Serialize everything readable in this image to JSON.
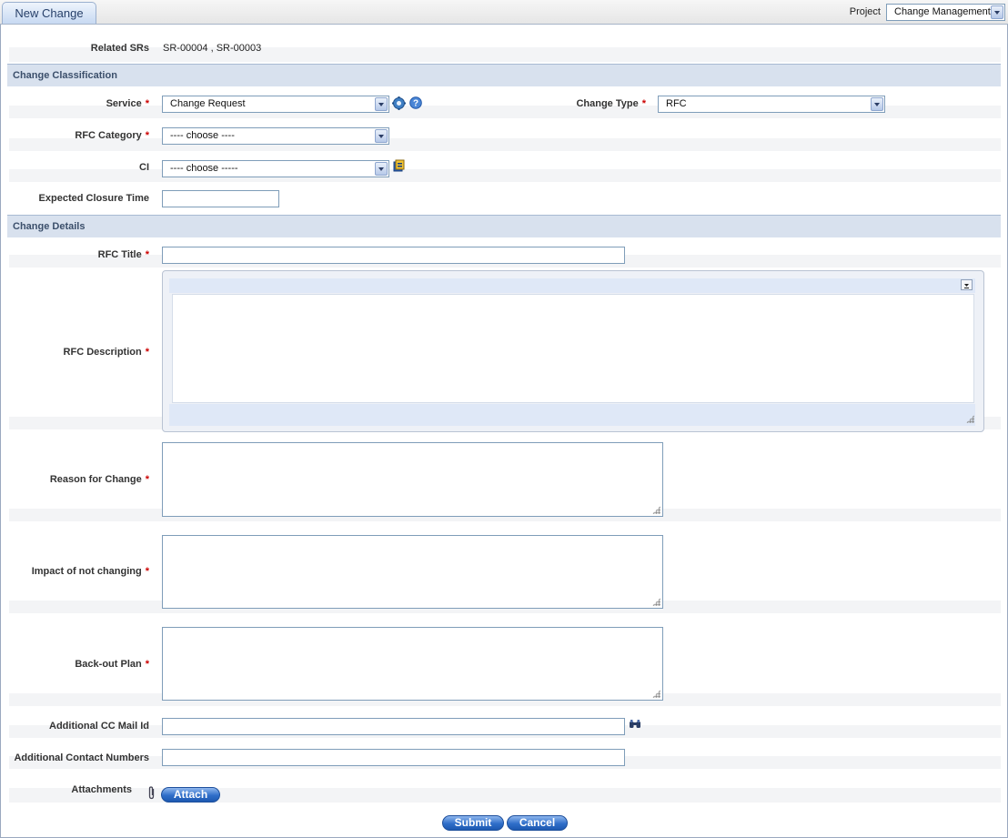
{
  "tab": {
    "title": "New Change"
  },
  "project": {
    "label": "Project",
    "value": "Change Management"
  },
  "related": {
    "label": "Related SRs",
    "value": "SR-00004 , SR-00003"
  },
  "sections": {
    "classification": "Change Classification",
    "details": "Change Details"
  },
  "fields": {
    "service": {
      "label": "Service",
      "value": "Change Request"
    },
    "change_type": {
      "label": "Change Type",
      "value": "RFC"
    },
    "rfc_category": {
      "label": "RFC Category",
      "value": "---- choose ----"
    },
    "ci": {
      "label": "CI",
      "value": "---- choose -----"
    },
    "closure_time": {
      "label": "Expected Closure Time",
      "value": ""
    },
    "rfc_title": {
      "label": "RFC Title",
      "value": ""
    },
    "rfc_description": {
      "label": "RFC Description",
      "value": ""
    },
    "reason": {
      "label": "Reason for Change",
      "value": ""
    },
    "impact": {
      "label": "Impact of not changing",
      "value": ""
    },
    "backout": {
      "label": "Back-out Plan",
      "value": ""
    },
    "cc_mail": {
      "label": "Additional CC Mail Id",
      "value": ""
    },
    "contact_numbers": {
      "label": "Additional Contact Numbers",
      "value": ""
    },
    "attachments": {
      "label": "Attachments"
    }
  },
  "required_marker": "*",
  "buttons": {
    "attach": "Attach",
    "submit": "Submit",
    "cancel": "Cancel"
  },
  "icons": {
    "service_settings": "gear-icon",
    "service_help": "help-icon",
    "ci_lookup": "lookup-icon",
    "cc_search": "binoculars-icon",
    "attachment": "paperclip-icon",
    "editor_toggle": "dropdown-icon"
  },
  "colors": {
    "accent": "#2f6ec9",
    "section_bg": "#d8e1ee",
    "required": "#cc0000",
    "editor_bg": "#dfe8f7"
  }
}
